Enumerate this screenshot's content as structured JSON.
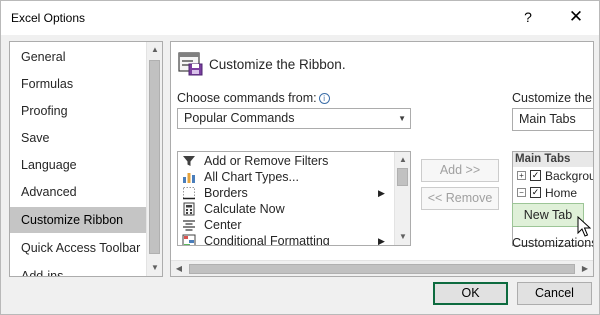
{
  "window": {
    "title": "Excel Options",
    "help_label": "?",
    "close_label": "✕"
  },
  "sidebar": {
    "items": [
      {
        "label": "General"
      },
      {
        "label": "Formulas"
      },
      {
        "label": "Proofing"
      },
      {
        "label": "Save"
      },
      {
        "label": "Language"
      },
      {
        "label": "Advanced"
      },
      {
        "label": "Customize Ribbon",
        "selected": true
      },
      {
        "label": "Quick Access Toolbar"
      },
      {
        "label": "Add-ins"
      }
    ]
  },
  "main": {
    "title": "Customize the Ribbon.",
    "choose_commands_label": "Choose commands from:",
    "choose_commands_value": "Popular Commands",
    "commands": [
      {
        "label": "Add or Remove Filters",
        "icon": "filter-icon"
      },
      {
        "label": "All Chart Types...",
        "icon": "chart-icon"
      },
      {
        "label": "Borders",
        "icon": "borders-icon",
        "has_submenu": true,
        "submenu_arrow": "▶"
      },
      {
        "label": "Calculate Now",
        "icon": "calculator-icon"
      },
      {
        "label": "Center",
        "icon": "center-align-icon"
      },
      {
        "label": "Conditional Formatting",
        "icon": "conditional-formatting-icon",
        "has_submenu": true,
        "submenu_arrow": "▶"
      }
    ],
    "add_button": "Add >>",
    "remove_button": "<< Remove",
    "customize_label": "Customize the",
    "customize_value": "Main Tabs",
    "tree": {
      "header": "Main Tabs",
      "items": [
        {
          "label": "Backgrou",
          "expander": "+",
          "checked": true
        },
        {
          "label": "Home",
          "expander": "−",
          "checked": true
        }
      ]
    },
    "new_tab_button": "New Tab",
    "customizations_label": "Customizations"
  },
  "footer": {
    "ok_label": "OK",
    "cancel_label": "Cancel"
  },
  "colors": {
    "ok_border": "#0d6b3f",
    "new_tab_bg": "#dff0d8",
    "selected_nav_bg": "#c5c5c5"
  }
}
